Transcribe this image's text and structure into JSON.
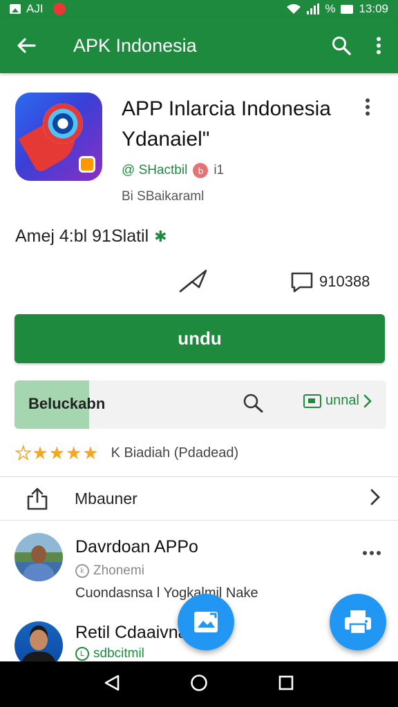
{
  "status_bar": {
    "left_text": "AJI",
    "time": "13:09",
    "percent_glyph": "%"
  },
  "app_bar": {
    "title": "APK Indonesia"
  },
  "app": {
    "name": "APP Inlarcia Indonesia Ydanaiel\"",
    "developer": "@ SHactbil",
    "dev_badge": "b",
    "dev_count": "i1",
    "category": "Bi SBaikaraml",
    "meta_text": "Amej 4:bl  91Slatil",
    "comment_count": "910388"
  },
  "install_button": {
    "label": "undu"
  },
  "progress": {
    "label": "Beluckabn",
    "fraction": 0.2,
    "link_label": "unnal"
  },
  "rating": {
    "value": 4.5,
    "max": 5,
    "label": "K Biadiah (Pdadead)"
  },
  "share_row": {
    "label": "Mbauner"
  },
  "reviews": [
    {
      "name": "Davrdoan APPo",
      "sub": "Zhonemi",
      "text": "Cuondasnsa l Yogkalmil Nake"
    },
    {
      "name": "Retil Cdaaivna",
      "sub": "sdbcitmil",
      "text": ""
    }
  ],
  "colors": {
    "primary": "#1e8a3e",
    "fab": "#2196f3",
    "star": "#f5a623"
  }
}
